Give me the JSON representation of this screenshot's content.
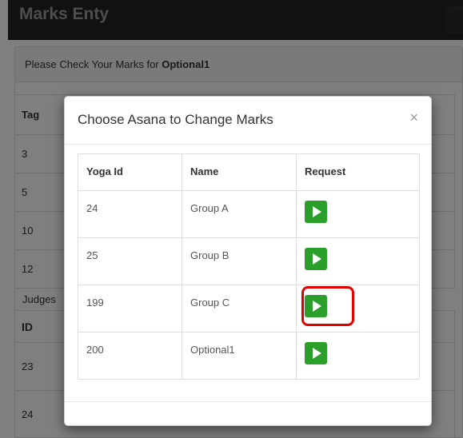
{
  "app": {
    "title": "Marks Enty"
  },
  "panel": {
    "prefix": "Please Check Your Marks for ",
    "target": "Optional1"
  },
  "background_table": {
    "header": "Tag",
    "rows": [
      "3",
      "5",
      "10",
      "12"
    ]
  },
  "judges": {
    "label": "Judges",
    "header": "ID",
    "rows": [
      "23",
      "24"
    ]
  },
  "modal": {
    "title": "Choose Asana to Change Marks",
    "close_label": "×",
    "columns": [
      "Yoga Id",
      "Name",
      "Request"
    ],
    "rows": [
      {
        "id": "24",
        "name": "Group A",
        "action": "play-icon"
      },
      {
        "id": "25",
        "name": "Group B",
        "action": "play-icon"
      },
      {
        "id": "199",
        "name": "Group C",
        "action": "play-icon"
      },
      {
        "id": "200",
        "name": "Optional1",
        "action": "play-icon"
      }
    ]
  },
  "colors": {
    "navbar": "#222222",
    "play_button": "#2aa02a",
    "highlight": "#e00000"
  }
}
